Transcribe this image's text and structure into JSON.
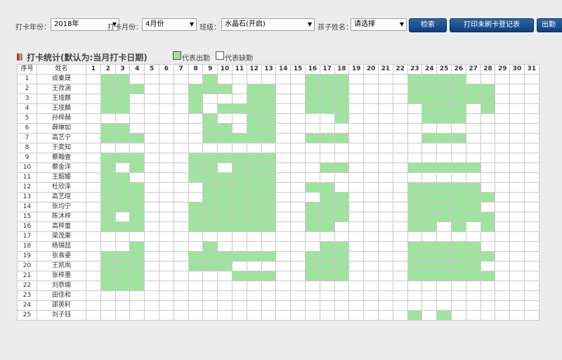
{
  "filters": {
    "year_label": "打卡年份：",
    "year_value": "2018年",
    "month_label": "打卡月份：",
    "month_value": "4月份",
    "class_label": "班级：",
    "class_value": "水晶石(开启)",
    "child_label": "孩子姓名：",
    "child_value": "请选择",
    "search_btn": "检索",
    "print_btn": "打印未刷卡登记表",
    "export_btn": "出勤"
  },
  "section": {
    "title": "打卡统计(默认为:当月打卡日期)",
    "legend_present": "代表出勤",
    "legend_absent": "代表缺勤"
  },
  "colors": {
    "present": "#9ee39e",
    "absent": "#ffffff",
    "button": "#1c5192"
  },
  "table": {
    "col_index": "序号",
    "col_name": "姓名",
    "days": [
      1,
      2,
      3,
      4,
      5,
      6,
      7,
      8,
      9,
      10,
      11,
      12,
      13,
      14,
      15,
      16,
      17,
      18,
      19,
      20,
      21,
      22,
      23,
      24,
      25,
      26,
      27,
      28,
      29,
      30,
      31
    ],
    "rows": [
      {
        "idx": "1",
        "name": "成秦晟",
        "present": [
          2,
          3,
          9,
          16,
          17,
          18,
          23,
          24,
          25,
          26
        ]
      },
      {
        "idx": "2",
        "name": "王孜涵",
        "present": [
          2,
          3,
          4,
          8,
          9,
          10,
          12,
          13,
          16,
          17,
          18,
          23,
          24,
          25,
          26,
          27,
          28
        ]
      },
      {
        "idx": "3",
        "name": "王垭麒",
        "present": [
          2,
          3,
          8,
          12,
          13,
          16,
          17,
          18,
          23,
          24,
          25,
          26,
          27,
          28
        ]
      },
      {
        "idx": "4",
        "name": "王垭麟",
        "present": [
          2,
          3,
          8,
          10,
          11,
          12,
          13,
          16,
          17,
          18,
          24,
          25,
          26,
          28
        ]
      },
      {
        "idx": "5",
        "name": "孙梓赫",
        "present": [
          9,
          12,
          13,
          18,
          24,
          25,
          26
        ]
      },
      {
        "idx": "6",
        "name": "薛琳如",
        "present": [
          2,
          3,
          9,
          10,
          12,
          13
        ]
      },
      {
        "idx": "7",
        "name": "高艺宁",
        "present": [
          2,
          3,
          4,
          9,
          10,
          11,
          12,
          13,
          16,
          17,
          18,
          24,
          25,
          26
        ]
      },
      {
        "idx": "8",
        "name": "于奕知",
        "present": []
      },
      {
        "idx": "9",
        "name": "蔡翰壹",
        "present": [
          2,
          3,
          4,
          8,
          9,
          10,
          11,
          12,
          13
        ]
      },
      {
        "idx": "10",
        "name": "蔡金洋",
        "present": [
          2,
          4,
          8,
          9,
          11,
          12,
          13,
          17,
          18,
          23,
          24,
          25,
          26,
          27
        ]
      },
      {
        "idx": "11",
        "name": "王韶媛",
        "present": [
          2,
          3,
          8,
          9,
          10,
          11,
          12,
          13
        ]
      },
      {
        "idx": "12",
        "name": "杜欣泽",
        "present": [
          2,
          3,
          4,
          9,
          10,
          11,
          12,
          13,
          16,
          17,
          23,
          24,
          25,
          26,
          27
        ]
      },
      {
        "idx": "13",
        "name": "高艺瑄",
        "present": [
          2,
          3,
          4,
          9,
          10,
          11,
          12,
          13,
          17,
          18,
          23,
          24,
          25,
          26,
          27,
          28
        ]
      },
      {
        "idx": "14",
        "name": "张均宁",
        "present": [
          2,
          3,
          4,
          8,
          9,
          10,
          11,
          12,
          13,
          16,
          17,
          18,
          23,
          24,
          25,
          26,
          27
        ]
      },
      {
        "idx": "15",
        "name": "陈沐梓",
        "present": [
          2,
          4,
          8,
          9,
          10,
          11,
          12,
          13,
          16,
          17,
          18,
          23,
          24,
          25,
          26,
          27,
          28
        ]
      },
      {
        "idx": "16",
        "name": "高梓童",
        "present": [
          2,
          3,
          4,
          8,
          9,
          10,
          11,
          12,
          13,
          16,
          17,
          23,
          24,
          26,
          28
        ]
      },
      {
        "idx": "17",
        "name": "梁茂果",
        "present": []
      },
      {
        "idx": "18",
        "name": "杨锦喆",
        "present": [
          4,
          9,
          17,
          18,
          23,
          24,
          25,
          26,
          27
        ]
      },
      {
        "idx": "19",
        "name": "张翕鎏",
        "present": [
          2,
          3,
          4,
          8,
          9,
          10,
          11,
          12,
          13,
          16,
          17,
          18,
          23,
          24,
          25,
          26,
          27,
          28
        ]
      },
      {
        "idx": "20",
        "name": "王凯岚",
        "present": [
          2,
          3,
          4,
          8,
          9,
          10,
          16,
          17,
          18,
          23,
          24,
          25,
          26,
          27
        ]
      },
      {
        "idx": "21",
        "name": "张梓墨",
        "present": [
          2,
          3,
          4,
          11,
          12,
          13,
          16,
          17,
          18,
          23,
          24,
          25,
          26,
          27,
          28
        ]
      },
      {
        "idx": "22",
        "name": "刘恭瑜",
        "present": [
          2,
          3,
          4
        ]
      },
      {
        "idx": "23",
        "name": "田佳和",
        "present": []
      },
      {
        "idx": "24",
        "name": "邵英轩",
        "present": []
      },
      {
        "idx": "25",
        "name": "刘子钰",
        "present": [
          23,
          25
        ]
      }
    ]
  }
}
